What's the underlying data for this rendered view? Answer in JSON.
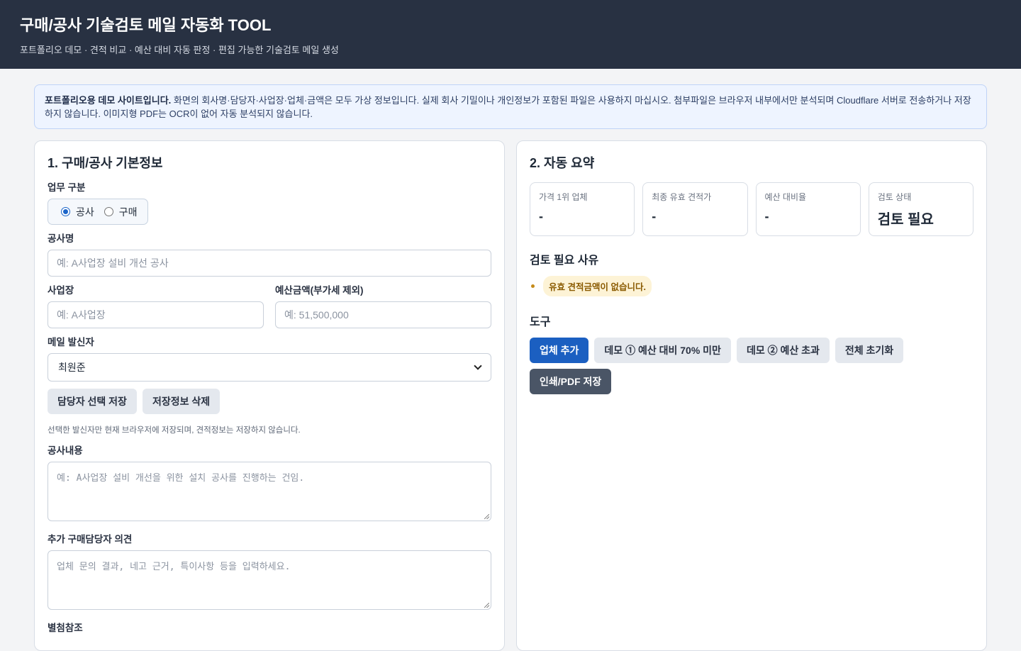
{
  "header": {
    "title": "구매/공사 기술검토 메일 자동화 TOOL",
    "subtitle": "포트폴리오 데모 · 견적 비교 · 예산 대비 자동 판정 · 편집 가능한 기술검토 메일 생성"
  },
  "notice": {
    "bold": "포트폴리오용 데모 사이트입니다.",
    "text": " 화면의 회사명·담당자·사업장·업체·금액은 모두 가상 정보입니다. 실제 회사 기밀이나 개인정보가 포함된 파일은 사용하지 마십시오. 첨부파일은 브라우저 내부에서만 분석되며 Cloudflare 서버로 전송하거나 저장하지 않습니다. 이미지형 PDF는 OCR이 없어 자동 분석되지 않습니다."
  },
  "form": {
    "heading": "1. 구매/공사 기본정보",
    "work_type_label": "업무 구분",
    "work_type_options": [
      "공사",
      "구매"
    ],
    "work_type_selected": "공사",
    "project_name_label": "공사명",
    "project_name_placeholder": "예: A사업장 설비 개선 공사",
    "site_label": "사업장",
    "site_placeholder": "예: A사업장",
    "budget_label": "예산금액(부가세 제외)",
    "budget_placeholder": "예: 51,500,000",
    "sender_label": "메일 발신자",
    "sender_value": "최원준",
    "save_sender_button": "담당자 선택 저장",
    "delete_saved_button": "저장정보 삭제",
    "hint": "선택한 발신자만 현재 브라우저에 저장되며, 견적정보는 저장하지 않습니다.",
    "content_label": "공사내용",
    "content_placeholder": "예: A사업장 설비 개선을 위한 설치 공사를 진행하는 건임.",
    "opinion_label": "추가 구매담당자 의견",
    "opinion_placeholder": "업체 문의 결과, 네고 근거, 특이사항 등을 입력하세요.",
    "next_label": "별첨참조"
  },
  "summary": {
    "heading": "2. 자동 요약",
    "stats": [
      {
        "label": "가격 1위 업체",
        "value": "-"
      },
      {
        "label": "최종 유효 견적가",
        "value": "-"
      },
      {
        "label": "예산 대비율",
        "value": "-"
      },
      {
        "label": "검토 상태",
        "value": "검토 필요"
      }
    ],
    "reasons_heading": "검토 필요 사유",
    "reasons": [
      "유효 견적금액이 없습니다."
    ],
    "tools_heading": "도구",
    "tools": [
      "업체 추가",
      "데모 ① 예산 대비 70% 미만",
      "데모 ② 예산 초과",
      "전체 초기화",
      "인쇄/PDF 저장"
    ]
  },
  "colors": {
    "header_bg": "#283142",
    "primary": "#1b5fc1",
    "dark_button": "#4a5566",
    "warning_pill": "#fdf3d6"
  }
}
